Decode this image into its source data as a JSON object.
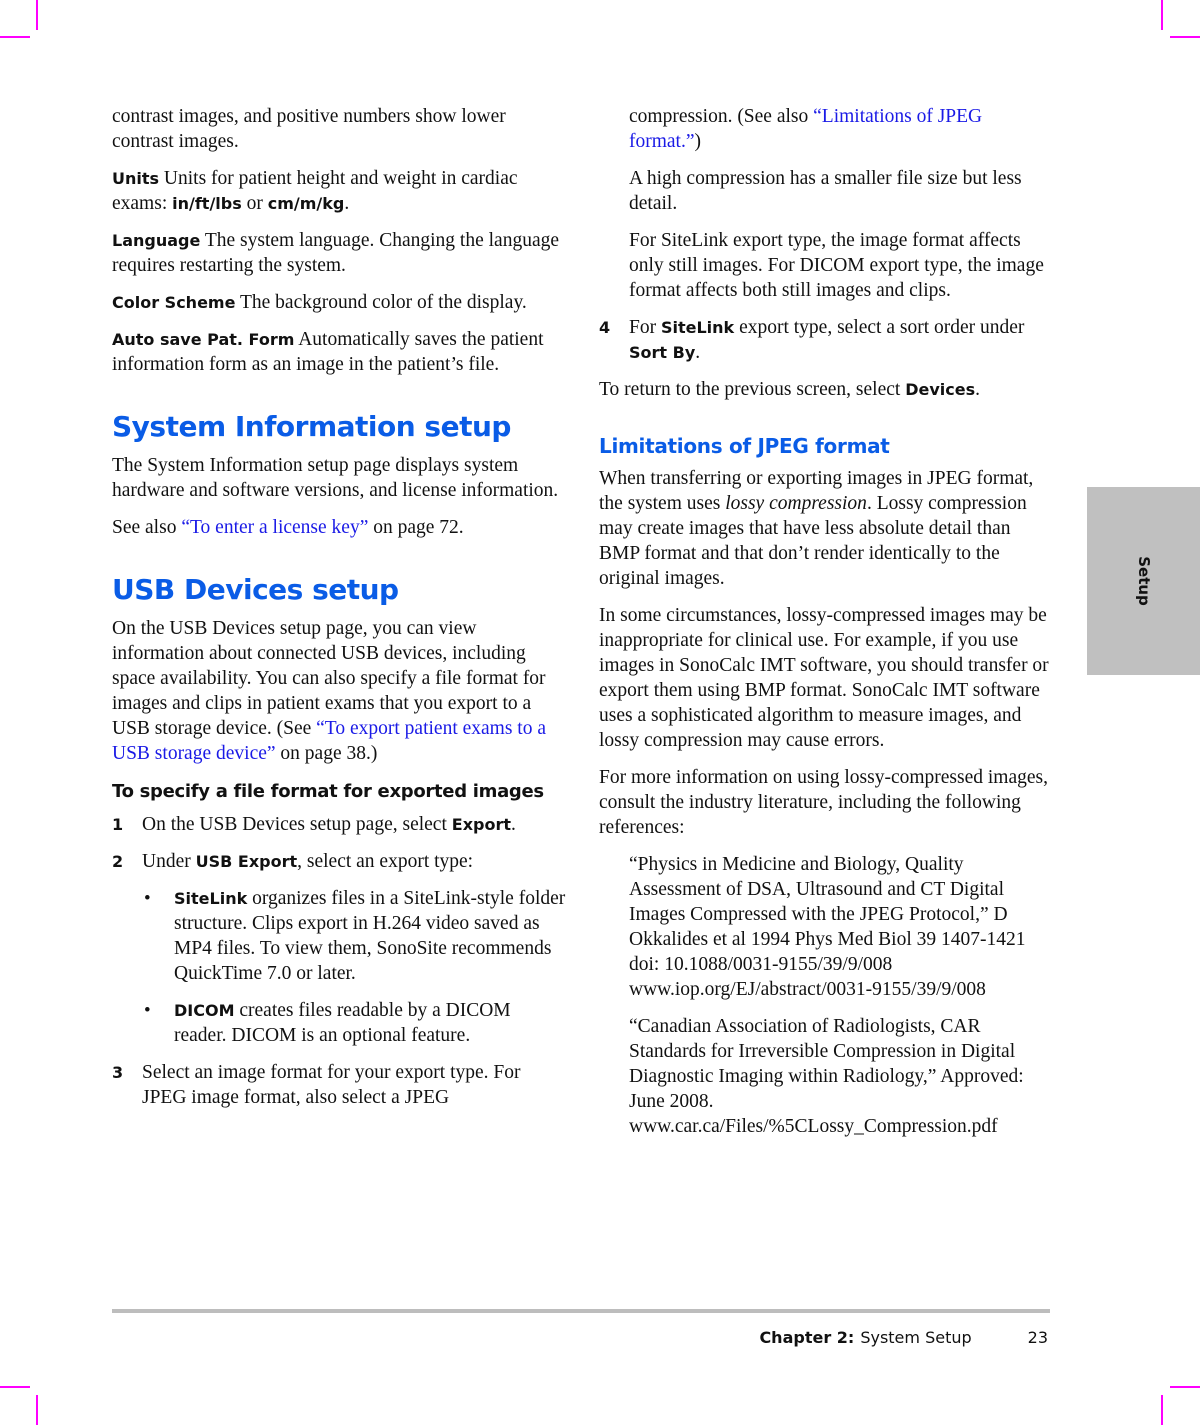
{
  "side_tab": {
    "label": "Setup"
  },
  "left_column": {
    "intro": "contrast images, and positive numbers show lower contrast images.",
    "settings": [
      {
        "term": "Units",
        "pre": "Units for patient height and weight in cardiac exams: ",
        "opt1": "in/ft/lbs",
        "mid": " or ",
        "opt2": "cm/m/kg",
        "post": "."
      },
      {
        "term": "Language",
        "text": "The system language. Changing the language requires restarting the system."
      },
      {
        "term": "Color Scheme",
        "text": "The background color of the display."
      },
      {
        "term": "Auto save Pat. Form",
        "text": "Automatically saves the patient information form as an image in the patient’s file."
      }
    ],
    "system_info": {
      "heading": "System Information setup",
      "body": "The System Information setup page displays system hardware and software versions, and license information.",
      "see_also_pre": "See also ",
      "see_also_link": "“To enter a license key”",
      "see_also_post": " on page 72."
    },
    "usb": {
      "heading": "USB Devices setup",
      "body_pre": "On the USB Devices setup page, you can view information about connected USB devices, including space availability. You can also specify a file format for images and clips in patient exams that you export to a USB storage device. (See ",
      "body_link": "“To export patient exams to a USB storage device”",
      "body_post": " on page 38.)",
      "procedure_heading": "To specify a file format for exported images",
      "steps": [
        {
          "num": "1",
          "pre": "On the USB Devices setup page, select ",
          "bold": "Export",
          "post": "."
        },
        {
          "num": "2",
          "pre": "Under ",
          "bold": "USB Export",
          "post": ", select an export type:"
        },
        {
          "num": "3",
          "text": "Select an image format for your export type. For JPEG image format, also select a JPEG"
        }
      ],
      "bullets": [
        {
          "bold": "SiteLink",
          "text": " organizes files in a SiteLink-style folder structure. Clips export in H.264 video saved as MP4 files. To view them, SonoSite recommends QuickTime 7.0 or later."
        },
        {
          "bold": "DICOM",
          "text": " creates files readable by a DICOM reader. DICOM is an optional feature."
        }
      ]
    }
  },
  "right_column": {
    "cont_pre": "compression. (See also ",
    "cont_link": "“Limitations of JPEG format.”",
    "cont_post": ")",
    "note1": "A high compression has a smaller file size but less detail.",
    "note2": "For SiteLink export type, the image format affects only still images. For DICOM export type, the image format affects both still images and clips.",
    "step4": {
      "num": "4",
      "pre": "For ",
      "bold1": "SiteLink",
      "mid": " export type, select a sort order under ",
      "bold2": "Sort By",
      "post": "."
    },
    "return_pre": "To return to the previous screen, select ",
    "return_bold": "Devices",
    "return_post": ".",
    "jpeg": {
      "heading": "Limitations of JPEG format",
      "p1_pre": "When transferring or exporting images in JPEG format, the system uses ",
      "p1_em": "lossy compression",
      "p1_post": ". Lossy compression may create images that have less absolute detail than BMP format and that don’t render identically to the original images.",
      "p2": "In some circumstances, lossy-compressed images may be inappropriate for clinical use. For example, if you use images in SonoCalc IMT software, you should transfer or export them using BMP format. SonoCalc IMT software uses a sophisticated algorithm to measure images, and lossy compression may cause errors.",
      "p3": "For more information on using lossy-compressed images, consult the industry literature, including the following references:",
      "references": [
        {
          "text": "“Physics in Medicine and Biology, Quality Assessment of DSA, Ultrasound and CT Digital Images Compressed with the JPEG Protocol,” D Okkalides et al 1994 Phys Med Biol 39 1407-1421 doi: 10.1088/0031-9155/39/9/008",
          "url": "www.iop.org/EJ/abstract/0031-9155/39/9/008"
        },
        {
          "text": "“Canadian Association of Radiologists, CAR Standards for Irreversible Compression in Digital Diagnostic Imaging within Radiology,” Approved: June 2008.",
          "url": "www.car.ca/Files/%5CLossy_Compression.pdf"
        }
      ]
    }
  },
  "footer": {
    "chapter": "Chapter 2:",
    "title": "System Setup",
    "page": "23"
  }
}
